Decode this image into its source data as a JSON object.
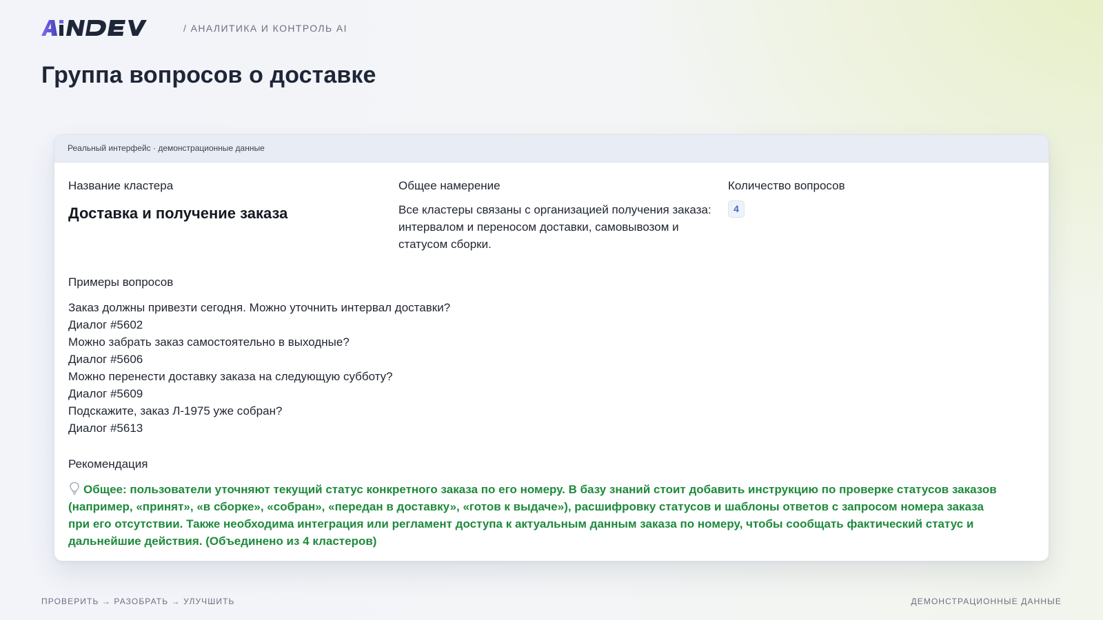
{
  "brand": {
    "logo_text": "AiNDEV",
    "logo_color": "#1f2638",
    "logo_accent": "#6b63d9"
  },
  "header": {
    "section_label": "/ АНАЛИТИКА И КОНТРОЛЬ AI"
  },
  "page": {
    "title": "Группа вопросов о доставке"
  },
  "card": {
    "topbar_label": "Реальный интерфейс · демонстрационные данные",
    "cluster_name": {
      "label": "Название кластера",
      "value": "Доставка и получение заказа"
    },
    "intent": {
      "label": "Общее намерение",
      "value": "Все кластеры связаны с организацией получения заказа: интервалом и переносом доставки, самовывозом и статусом сборки."
    },
    "question_count": {
      "label": "Количество вопросов",
      "value": "4"
    },
    "examples": {
      "label": "Примеры вопросов",
      "items": [
        {
          "question": "Заказ должны привезти сегодня. Можно уточнить интервал доставки?",
          "dialog": "Диалог #5602"
        },
        {
          "question": "Можно забрать заказ самостоятельно в выходные?",
          "dialog": "Диалог #5606"
        },
        {
          "question": "Можно перенести доставку заказа на следующую субботу?",
          "dialog": "Диалог #5609"
        },
        {
          "question": "Подскажите, заказ Л-1975 уже собран?",
          "dialog": "Диалог #5613"
        }
      ]
    },
    "recommendation": {
      "label": "Рекомендация",
      "icon": "lightbulb-icon",
      "text": "Общее: пользователи уточняют текущий статус конкретного заказа по его номеру. В базу знаний стоит добавить инструкцию по проверке статусов заказов (например, «принят», «в сборке», «собран», «передан в доставку», «готов к выдаче»), расшифровку статусов и шаблоны ответов с запросом номера заказа при его отсутствии. Также необходима интеграция или регламент доступа к актуальным данным заказа по номеру, чтобы сообщать фактический статус и дальнейшие действия. (Объединено из 4 кластеров)",
      "color": "#1e8a3c"
    }
  },
  "footer": {
    "left": "ПРОВЕРИТЬ → РАЗОБРАТЬ → УЛУЧШИТЬ",
    "right": "ДЕМОНСТРАЦИОННЫЕ ДАННЫЕ"
  }
}
